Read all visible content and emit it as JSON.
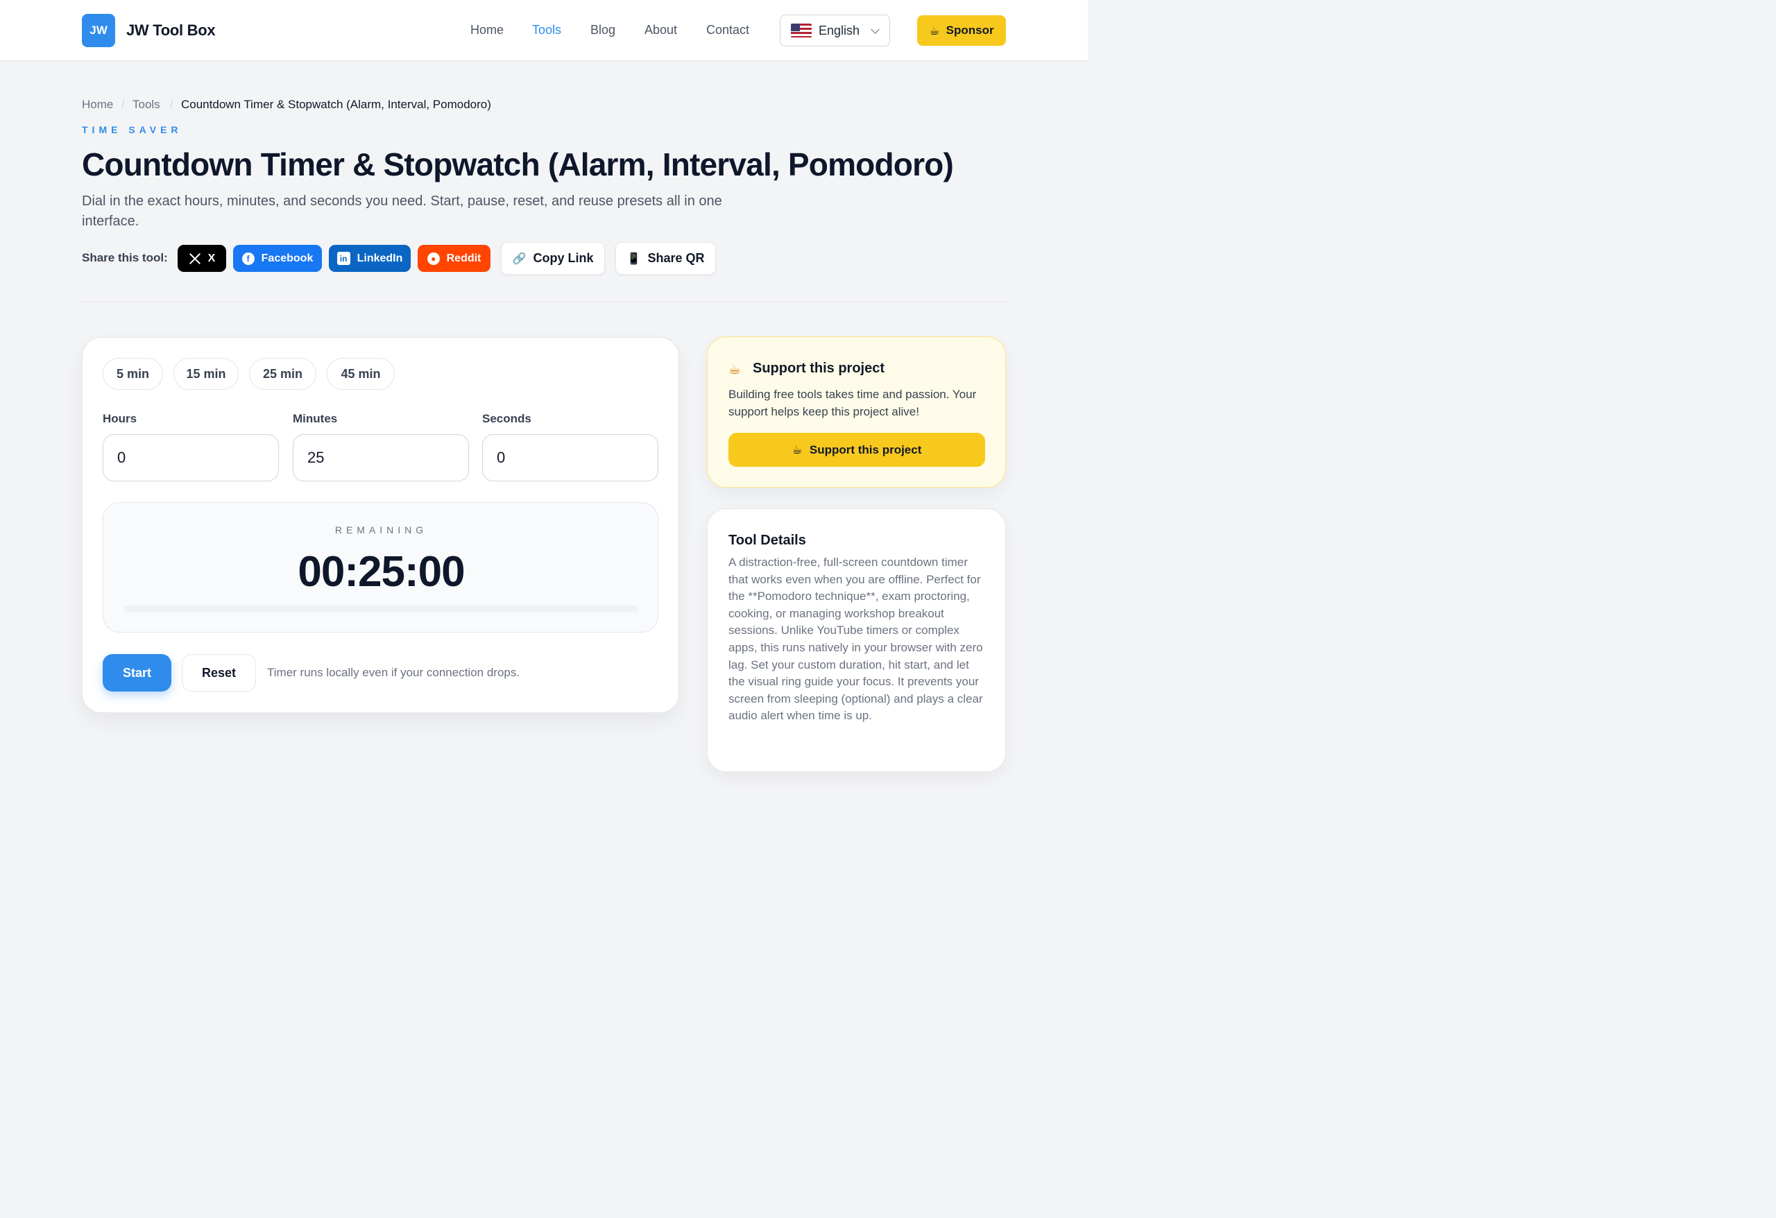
{
  "header": {
    "logo": "JW",
    "brand": "JW Tool Box",
    "nav": [
      "Home",
      "Tools",
      "Blog",
      "About",
      "Contact"
    ],
    "active_nav": "Tools",
    "language": "English",
    "sponsor_label": "Sponsor",
    "accent": "#2f8cec",
    "sponsor_color": "#f8c91d"
  },
  "breadcrumb": [
    "Home",
    "Tools",
    "Countdown Timer & Stopwatch (Alarm, Interval, Pomodoro)"
  ],
  "page": {
    "eyebrow": "TIME SAVER",
    "title": "Countdown Timer & Stopwatch (Alarm, Interval, Pomodoro)",
    "subtitle": "Dial in the exact hours, minutes, and seconds you need. Start, pause, reset, and reuse presets all in one interface."
  },
  "share": {
    "label": "Share this tool:",
    "x": "X",
    "facebook": "Facebook",
    "linkedin": "LinkedIn",
    "reddit": "Reddit",
    "copy_link": "Copy Link",
    "share_qr": "Share QR"
  },
  "timer": {
    "presets": [
      "5 min",
      "15 min",
      "25 min",
      "45 min"
    ],
    "hours_label": "Hours",
    "minutes_label": "Minutes",
    "seconds_label": "Seconds",
    "hours": "0",
    "minutes": "25",
    "seconds": "0",
    "remaining_label": "REMAINING",
    "remaining": "00:25:00",
    "progress_fraction": 0,
    "start_label": "Start",
    "reset_label": "Reset",
    "note": "Timer runs locally even if your connection drops."
  },
  "support": {
    "title": "Support this project",
    "text": "Building free tools takes time and passion. Your support helps keep this project alive!",
    "button": "Support this project"
  },
  "details": {
    "title": "Tool Details",
    "text": "A distraction-free, full-screen countdown timer that works even when you are offline. Perfect for the **Pomodoro technique**, exam proctoring, cooking, or managing workshop breakout sessions. Unlike YouTube timers or complex apps, this runs natively in your browser with zero lag. Set your custom duration, hit start, and let the visual ring guide your focus. It prevents your screen from sleeping (optional) and plays a clear audio alert when time is up."
  }
}
